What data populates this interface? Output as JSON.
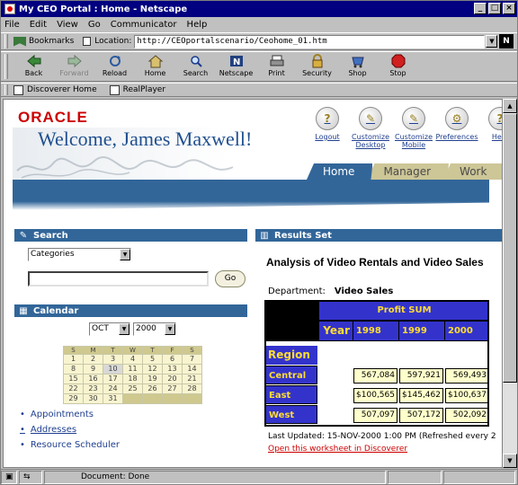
{
  "window": {
    "title": "My CEO Portal : Home - Netscape"
  },
  "menu": [
    "File",
    "Edit",
    "View",
    "Go",
    "Communicator",
    "Help"
  ],
  "location": {
    "bookmarks_label": "Bookmarks",
    "location_label": "Location:",
    "url": "http://CEOportalscenario/Ceohome_01.htm"
  },
  "nav_buttons": [
    {
      "label": "Back",
      "icon": "back-arrow-icon",
      "enabled": true
    },
    {
      "label": "Forward",
      "icon": "forward-arrow-icon",
      "enabled": false
    },
    {
      "label": "Reload",
      "icon": "reload-icon",
      "enabled": true
    },
    {
      "label": "Home",
      "icon": "home-icon",
      "enabled": true
    },
    {
      "label": "Search",
      "icon": "search-icon",
      "enabled": true
    },
    {
      "label": "Netscape",
      "icon": "netscape-icon",
      "enabled": true
    },
    {
      "label": "Print",
      "icon": "print-icon",
      "enabled": true
    },
    {
      "label": "Security",
      "icon": "lock-icon",
      "enabled": true
    },
    {
      "label": "Shop",
      "icon": "shop-icon",
      "enabled": true
    },
    {
      "label": "Stop",
      "icon": "stop-icon",
      "enabled": true
    }
  ],
  "personal_toolbar": [
    "Discoverer Home",
    "RealPlayer"
  ],
  "portal": {
    "logo": "ORACLE",
    "welcome": "Welcome, James Maxwell!",
    "tools": [
      {
        "label": "Logout",
        "glyph": "?"
      },
      {
        "label": "Customize Desktop",
        "glyph": "✎"
      },
      {
        "label": "Customize Mobile",
        "glyph": "✎"
      },
      {
        "label": "Preferences",
        "glyph": "⚙"
      },
      {
        "label": "Help",
        "glyph": "?"
      }
    ],
    "tabs": [
      {
        "label": "Home",
        "active": true
      },
      {
        "label": "Manager",
        "active": false
      },
      {
        "label": "Work",
        "active": false
      }
    ]
  },
  "search": {
    "title": "Search",
    "category": "Categories",
    "go_label": "Go"
  },
  "calendar": {
    "title": "Calendar",
    "month": "OCT",
    "year": "2000",
    "weekdays": [
      "S",
      "M",
      "T",
      "W",
      "T",
      "F",
      "S"
    ],
    "weeks": [
      [
        "1",
        "2",
        "3",
        "4",
        "5",
        "6",
        "7"
      ],
      [
        "8",
        "9",
        "10",
        "11",
        "12",
        "13",
        "14"
      ],
      [
        "15",
        "16",
        "17",
        "18",
        "19",
        "20",
        "21"
      ],
      [
        "22",
        "23",
        "24",
        "25",
        "26",
        "27",
        "28"
      ],
      [
        "29",
        "30",
        "31",
        "",
        "",
        "",
        ""
      ]
    ],
    "highlight_day": "10"
  },
  "links": [
    "Appointments",
    "Addresses",
    "Resource Scheduler"
  ],
  "results": {
    "title": "Results Set",
    "heading": "Analysis of Video Rentals and Video Sales",
    "department_label": "Department:",
    "department_value": "Video Sales",
    "measure": "Profit SUM",
    "year_label": "Year",
    "years": [
      "1998",
      "1999",
      "2000"
    ],
    "region_label": "Region",
    "rows": [
      {
        "region": "Central",
        "values": [
          "567,084",
          "597,921",
          "569,493"
        ]
      },
      {
        "region": "East",
        "values": [
          "$100,565",
          "$145,462",
          "$100,637"
        ]
      },
      {
        "region": "West",
        "values": [
          "507,097",
          "507,172",
          "502,092"
        ]
      }
    ],
    "updated": "Last Updated: 15-NOV-2000 1:00 PM (Refreshed every 2",
    "open_link": "Open this worksheet in Discoverer"
  },
  "status": {
    "text": "Document: Done"
  }
}
